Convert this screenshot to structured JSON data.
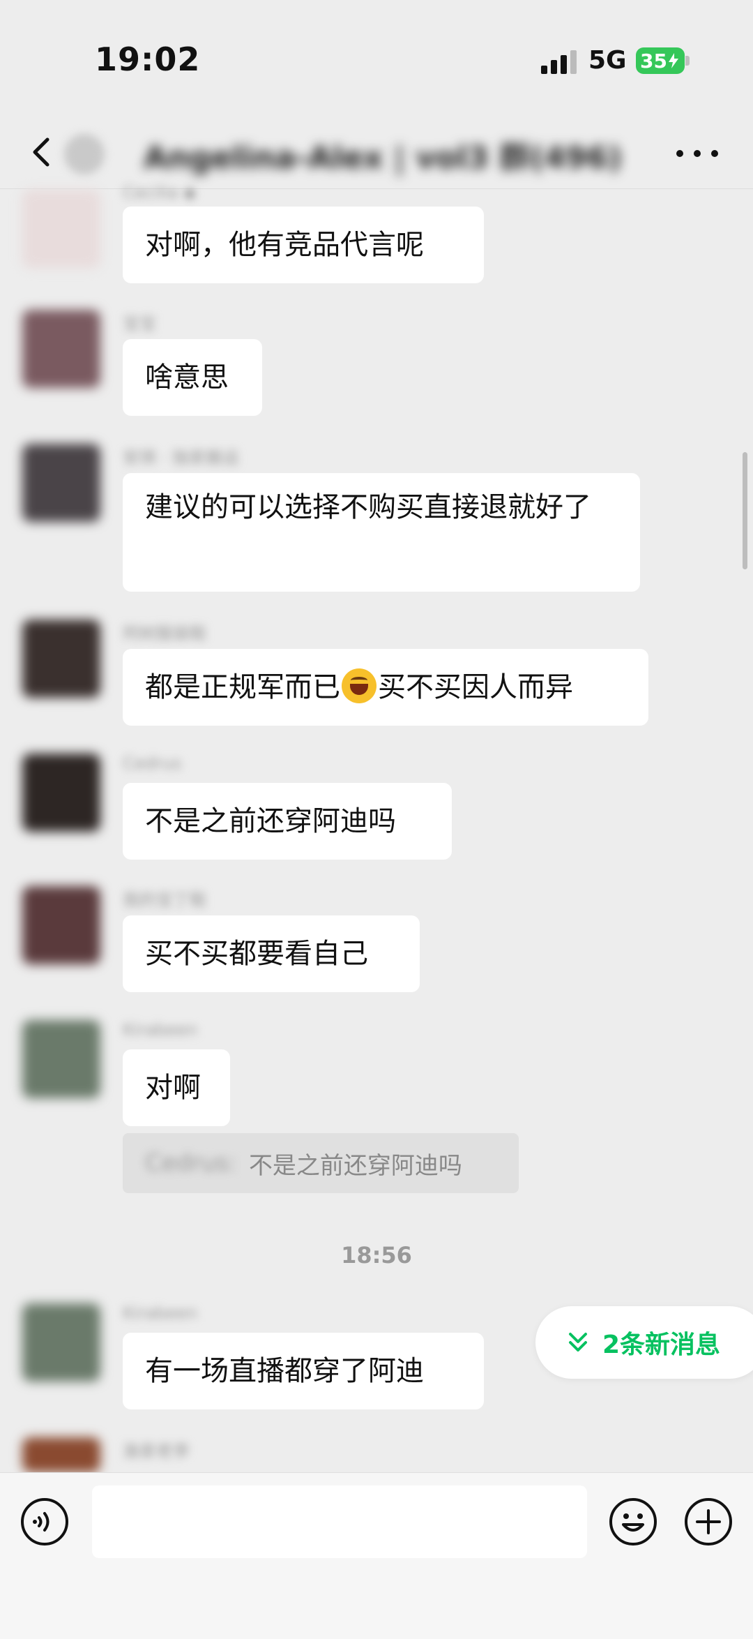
{
  "status_bar": {
    "time": "19:02",
    "network": "5G",
    "battery": "35"
  },
  "header": {
    "title": "Angelina-Alex | vol3 群(496)"
  },
  "messages": [
    {
      "sender": "Cecilia ◆",
      "text": "对啊，他有竞品代言呢",
      "avatar_color": "#e8dcdc"
    },
    {
      "sender": "宝宝",
      "text": "啥意思",
      "avatar_color": "#7a5a60"
    },
    {
      "sender": "安琪 · 独家搬运",
      "text": "建议的可以选择不购买直接退就好了",
      "avatar_color": "#4a4448"
    },
    {
      "sender": "阿树服装鞋",
      "text_before": "都是正规军而已",
      "emoji": "grinning-squinting-emoji",
      "text_after": "买不买因人而异",
      "avatar_color": "#3a302e"
    },
    {
      "sender": "Cedrus",
      "text": "不是之前还穿阿迪吗",
      "avatar_color": "#2d2624"
    },
    {
      "sender": "我的宝丁鞋",
      "text": "买不买都要看自己",
      "avatar_color": "#5a3a3c"
    },
    {
      "sender": "Kirabeen",
      "text": "对啊",
      "avatar_color": "#6a7a6a"
    },
    {
      "sender": "Kirabeen",
      "text": "有一场直播都穿了阿迪",
      "avatar_color": "#6a7a6a"
    },
    {
      "sender": "渔家老李",
      "text": "",
      "avatar_color": "#8a4a30"
    }
  ],
  "quote": {
    "name": "Cedrus:",
    "text": "不是之前还穿阿迪吗"
  },
  "timestamp": "18:56",
  "new_messages": "2条新消息",
  "input": {
    "value": "",
    "placeholder": ""
  },
  "colors": {
    "accent": "#07c160",
    "background": "#ededed",
    "bubble": "#ffffff",
    "battery": "#35c759"
  }
}
